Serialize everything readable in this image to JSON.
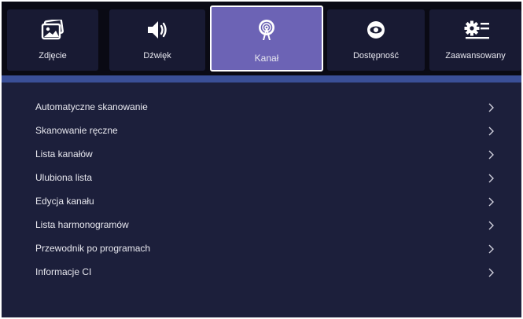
{
  "tabs": [
    {
      "label": "Zdjęcie",
      "icon": "picture-icon"
    },
    {
      "label": "Dźwięk",
      "icon": "speaker-icon"
    },
    {
      "label": "Kanał",
      "icon": "broadcast-icon",
      "active": true
    },
    {
      "label": "Dostępność",
      "icon": "eye-icon"
    },
    {
      "label": "Zaawansowany",
      "icon": "gear-list-icon"
    }
  ],
  "menu": {
    "items": [
      {
        "label": "Automatyczne skanowanie"
      },
      {
        "label": "Skanowanie ręczne"
      },
      {
        "label": "Lista kanałów"
      },
      {
        "label": "Ulubiona lista"
      },
      {
        "label": "Edycja kanału"
      },
      {
        "label": "Lista harmonogramów"
      },
      {
        "label": "Przewodnik po programach"
      },
      {
        "label": "Informacje CI"
      }
    ]
  },
  "colors": {
    "background": "#1c1f3b",
    "topbar": "#0a0a14",
    "tab": "#181a33",
    "active_tab": "#6c63b5",
    "accent_line": "#3a4f97"
  }
}
